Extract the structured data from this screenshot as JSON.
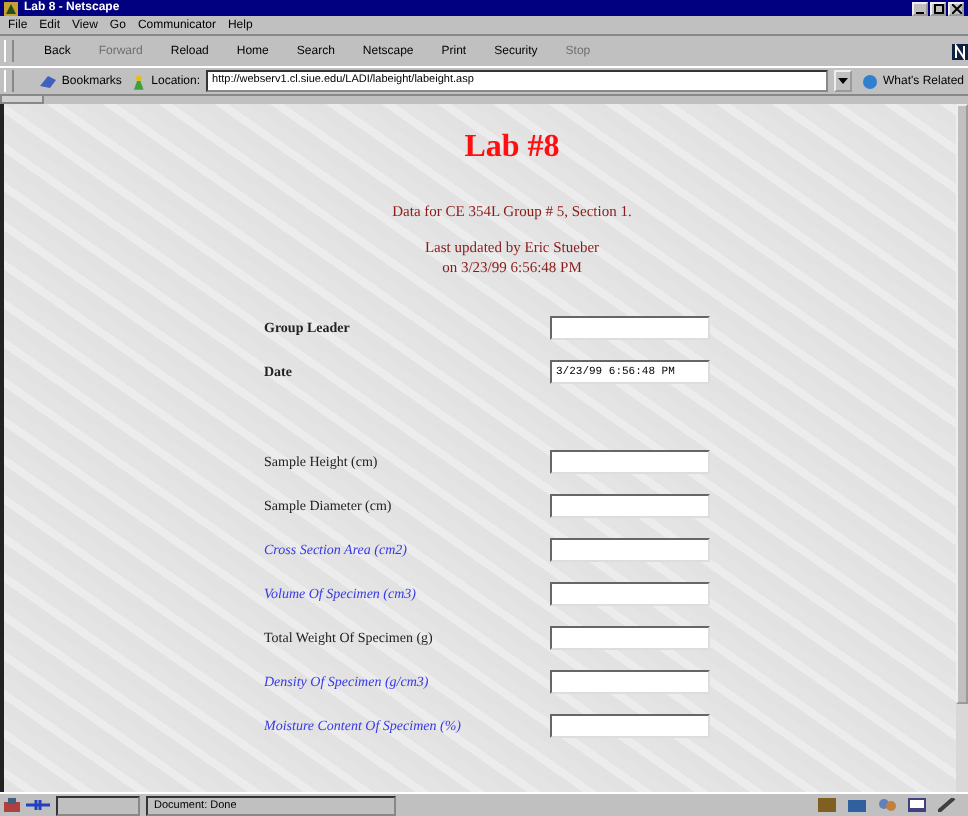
{
  "window": {
    "title": "Lab 8 - Netscape"
  },
  "menu": [
    "File",
    "Edit",
    "View",
    "Go",
    "Communicator",
    "Help"
  ],
  "toolbar": [
    {
      "label": "Back",
      "disabled": false
    },
    {
      "label": "Forward",
      "disabled": true
    },
    {
      "label": "Reload",
      "disabled": false
    },
    {
      "label": "Home",
      "disabled": false
    },
    {
      "label": "Search",
      "disabled": false
    },
    {
      "label": "Netscape",
      "disabled": false
    },
    {
      "label": "Print",
      "disabled": false
    },
    {
      "label": "Security",
      "disabled": false
    },
    {
      "label": "Stop",
      "disabled": true
    }
  ],
  "location_bar": {
    "bookmarks": "Bookmarks",
    "label": "Location:",
    "url": "http://webserv1.cl.siue.edu/LADI/labeight/labeight.asp",
    "related": "What's Related"
  },
  "page": {
    "heading": "Lab #8",
    "subtitle": "Data for CE 354L Group # 5, Section 1.",
    "updated": [
      "Last updated by Eric Stueber",
      "on 3/23/99 6:56:48 PM"
    ],
    "header_fields": [
      {
        "label": "Group Leader",
        "kind": "bold"
      },
      {
        "label": "Date",
        "kind": "bold",
        "value": "3/23/99 6:56:48 PM"
      }
    ],
    "fields": [
      {
        "label": "Sample Height (cm)",
        "kind": "plain"
      },
      {
        "label": "Sample Diameter (cm)",
        "kind": "plain"
      },
      {
        "label": "Cross Section Area (cm2)",
        "kind": "computed"
      },
      {
        "label": "Volume Of Specimen (cm3)",
        "kind": "computed"
      },
      {
        "label": "Total Weight Of Specimen (g)",
        "kind": "plain"
      },
      {
        "label": "Density Of Specimen (g/cm3)",
        "kind": "computed"
      },
      {
        "label": "Moisture Content Of Specimen (%)",
        "kind": "computed"
      }
    ]
  },
  "status_bar": {
    "text": "Document: Done"
  }
}
